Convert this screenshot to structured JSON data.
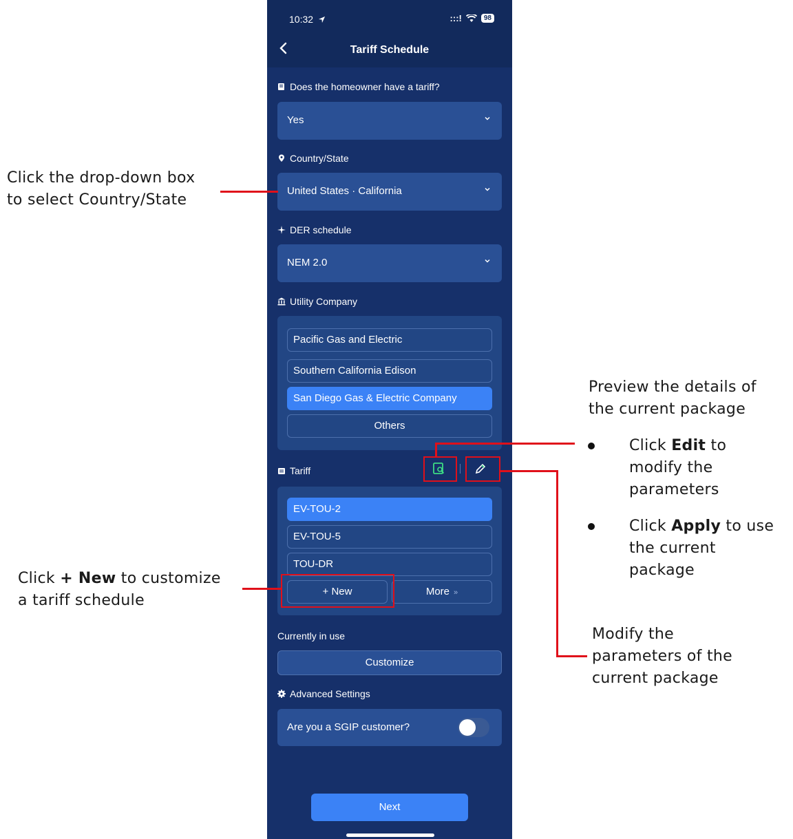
{
  "status_bar": {
    "time": "10:32",
    "signal": ":::!",
    "battery": "98"
  },
  "nav": {
    "title": "Tariff Schedule"
  },
  "tariff_question": {
    "label": "Does the homeowner have a tariff?",
    "value": "Yes"
  },
  "country_state": {
    "label": "Country/State",
    "value": "United States · California"
  },
  "der_schedule": {
    "label": "DER schedule",
    "value": "NEM 2.0"
  },
  "utility": {
    "label": "Utility Company",
    "options": [
      "Pacific Gas and Electric",
      "Southern California Edison",
      "San Diego Gas & Electric Company",
      "Others"
    ],
    "selected": "San Diego Gas & Electric Company"
  },
  "tariff": {
    "label": "Tariff",
    "options": [
      "EV-TOU-2",
      "EV-TOU-5",
      "TOU-DR"
    ],
    "selected": "EV-TOU-2",
    "new_label": "+ New",
    "more_label": "More",
    "more_arrows": "»"
  },
  "currently_in_use": {
    "label": "Currently in use",
    "value": "Customize"
  },
  "advanced": {
    "label": "Advanced Settings",
    "sgip_question": "Are you a SGIP customer?",
    "sgip_enabled": false
  },
  "next_label": "Next",
  "annotations": {
    "country": {
      "line1": "Click the drop-down box",
      "line2": "to select Country/State"
    },
    "new": {
      "pre": "Click ",
      "bold": "+ New",
      "post": " to customize",
      "line2": "a tariff schedule"
    },
    "preview": {
      "line1": "Preview the details of",
      "line2": "the current package"
    },
    "edit": {
      "pre": "Click ",
      "bold": "Edit",
      "post": " to",
      "line2": "modify the",
      "line3": "parameters"
    },
    "apply": {
      "pre": "Click ",
      "bold": "Apply",
      "post": " to use",
      "line2": "the current",
      "line3": "package"
    },
    "modify": {
      "line1": "Modify the",
      "line2": "parameters of the",
      "line3": "current package"
    }
  }
}
